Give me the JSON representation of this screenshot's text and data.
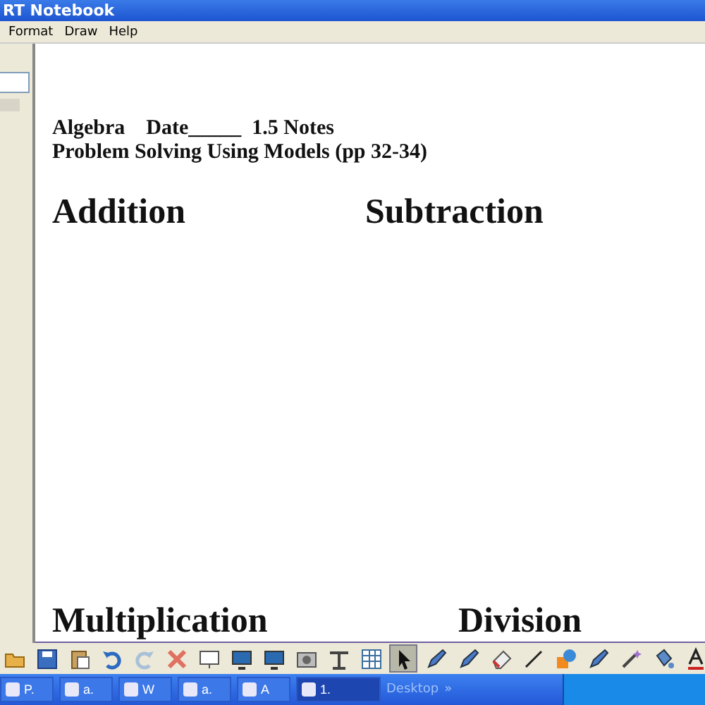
{
  "window": {
    "title": "RT Notebook"
  },
  "menu": [
    "Format",
    "Draw",
    "Help"
  ],
  "page": {
    "header": "Algebra    Date_____  1.5 Notes",
    "subtitle": "Problem Solving Using Models (pp 32-34)",
    "headings": [
      "Addition",
      "Subtraction",
      "Multiplication",
      "Division"
    ]
  },
  "toolbar": [
    {
      "kind": "open",
      "selected": false
    },
    {
      "kind": "save",
      "selected": false
    },
    {
      "kind": "paste",
      "selected": false
    },
    {
      "kind": "undo",
      "selected": false
    },
    {
      "kind": "redo",
      "selected": false
    },
    {
      "kind": "delete",
      "selected": false
    },
    {
      "kind": "screen",
      "selected": false
    },
    {
      "kind": "monitor",
      "selected": false
    },
    {
      "kind": "monitor",
      "selected": false
    },
    {
      "kind": "camera",
      "selected": false
    },
    {
      "kind": "projector",
      "selected": false
    },
    {
      "kind": "table",
      "selected": false
    },
    {
      "kind": "select",
      "selected": true
    },
    {
      "kind": "pen",
      "selected": false
    },
    {
      "kind": "pen",
      "selected": false
    },
    {
      "kind": "eraser",
      "selected": false
    },
    {
      "kind": "line",
      "selected": false
    },
    {
      "kind": "shape",
      "selected": false
    },
    {
      "kind": "pen",
      "selected": false
    },
    {
      "kind": "wand",
      "selected": false
    },
    {
      "kind": "fill",
      "selected": false
    },
    {
      "kind": "text",
      "selected": false
    }
  ],
  "taskbar": {
    "tasks": [
      {
        "label": "P.",
        "selected": false
      },
      {
        "label": "a.",
        "selected": false
      },
      {
        "label": "W",
        "selected": false
      },
      {
        "label": "a.",
        "selected": false
      },
      {
        "label": "A",
        "selected": false
      },
      {
        "label": "1.",
        "selected": true
      }
    ],
    "desktop": "Desktop",
    "more": "»"
  }
}
